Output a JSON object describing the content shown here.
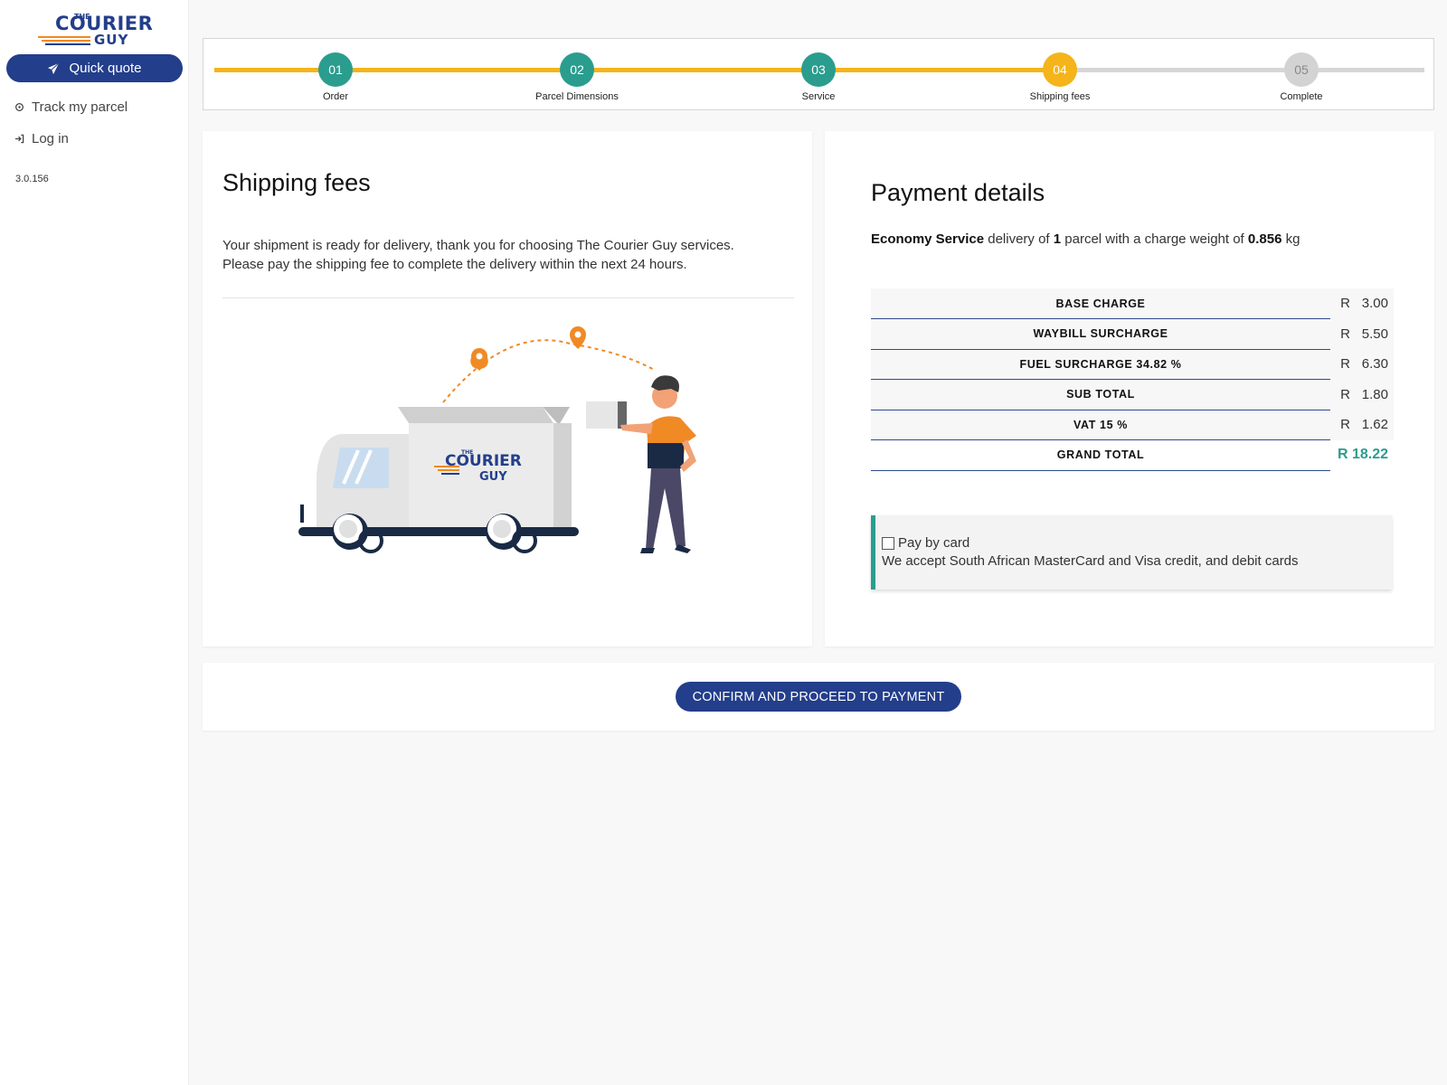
{
  "sidebar": {
    "logo": {
      "the": "THE",
      "courier": "COURIER",
      "guy": "GUY"
    },
    "quick_quote": "Quick quote",
    "track": "Track my parcel",
    "login": "Log in",
    "version": "3.0.156",
    "icons": {
      "quick_quote": "paper-plane-icon",
      "track": "target-icon",
      "login": "sign-in-icon"
    }
  },
  "stepper": {
    "steps": [
      {
        "num": "01",
        "label": "Order",
        "state": "done"
      },
      {
        "num": "02",
        "label": "Parcel Dimensions",
        "state": "done"
      },
      {
        "num": "03",
        "label": "Service",
        "state": "done"
      },
      {
        "num": "04",
        "label": "Shipping fees",
        "state": "current"
      },
      {
        "num": "05",
        "label": "Complete",
        "state": "pending"
      }
    ],
    "colors": {
      "done": "#2a9d8f",
      "current": "#f4b41a",
      "pending": "#d3d3d3",
      "track_active": "#f4b41a",
      "track_inactive": "#d6d6d6"
    }
  },
  "shipping": {
    "title": "Shipping fees",
    "line1": "Your shipment is ready for delivery, thank you for choosing The Courier Guy services.",
    "line2": "Please pay the shipping fee to complete the delivery within the next 24 hours.",
    "truck_logo": {
      "the": "THE",
      "courier": "COURIER",
      "guy": "GUY"
    }
  },
  "payment": {
    "title": "Payment details",
    "summary": {
      "service": "Economy Service",
      "t1": " delivery of ",
      "count": "1",
      "t2": " parcel with a charge weight of ",
      "weight": "0.856",
      "unit": " kg"
    },
    "fees": [
      {
        "label": "BASE CHARGE",
        "currency": "R",
        "value": "3.00"
      },
      {
        "label": "WAYBILL SURCHARGE",
        "currency": "R",
        "value": "5.50"
      },
      {
        "label": "FUEL SURCHARGE 34.82 %",
        "currency": "R",
        "value": "6.30"
      },
      {
        "label": "SUB TOTAL",
        "currency": "R",
        "value": "1.80"
      },
      {
        "label": "VAT 15 %",
        "currency": "R",
        "value": "1.62"
      }
    ],
    "grand_total": {
      "label": "GRAND TOTAL",
      "value": "R 18.22"
    },
    "pay_by_card": {
      "label": "Pay by card",
      "checked": false,
      "note": "We accept South African MasterCard and Visa credit, and debit cards"
    }
  },
  "confirm_button": "CONFIRM AND PROCEED TO PAYMENT",
  "colors": {
    "brand_blue": "#233e8b",
    "teal": "#2a9d8f",
    "orange": "#f08a24",
    "amber": "#f4b41a"
  }
}
